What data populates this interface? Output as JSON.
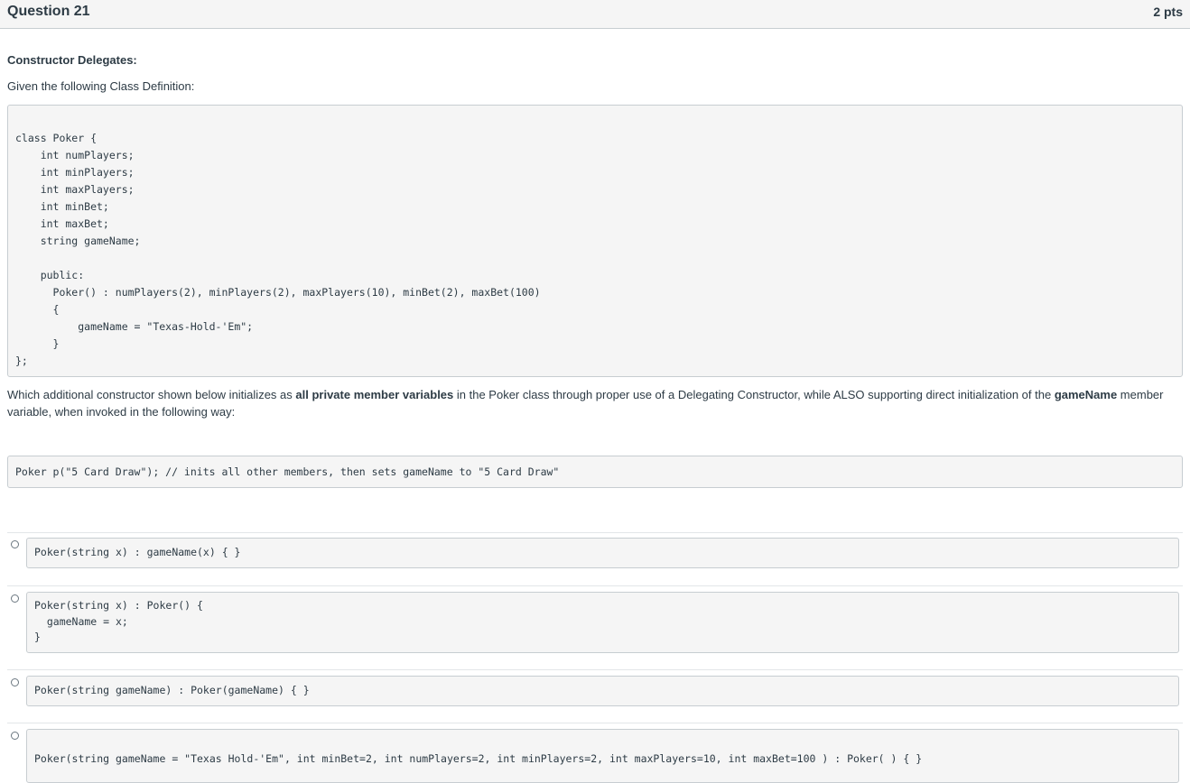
{
  "header": {
    "title": "Question 21",
    "points": "2 pts"
  },
  "subtitle": "Constructor Delegates:",
  "intro": "Given the following Class Definition:",
  "class_code": "class Poker {\n    int numPlayers;\n    int minPlayers;\n    int maxPlayers;\n    int minBet;\n    int maxBet;\n    string gameName;\n\n    public:\n      Poker() : numPlayers(2), minPlayers(2), maxPlayers(10), minBet(2), maxBet(100)\n      {\n          gameName = \"Texas-Hold-'Em\";\n      }\n};",
  "question": {
    "part1": "Which additional constructor shown below  initializes as ",
    "bold1": "all private member variables",
    "part2": " in the Poker class through proper use of a Delegating Constructor, while ALSO supporting direct initialization of the ",
    "bold2": "gameName",
    "part3": " member variable, when invoked in the following way:"
  },
  "usage_code": "Poker p(\"5 Card Draw\"); // inits all other members, then sets gameName to \"5 Card Draw\"",
  "answers": [
    {
      "code": "Poker(string x) : gameName(x) { }"
    },
    {
      "code": "Poker(string x) : Poker() {\n  gameName = x;\n}"
    },
    {
      "code": "Poker(string gameName) : Poker(gameName) { }"
    },
    {
      "code": "Poker(string gameName = \"Texas Hold-'Em\", int minBet=2, int numPlayers=2, int minPlayers=2, int maxPlayers=10, int maxBet=100 ) : Poker( ) { }"
    }
  ]
}
